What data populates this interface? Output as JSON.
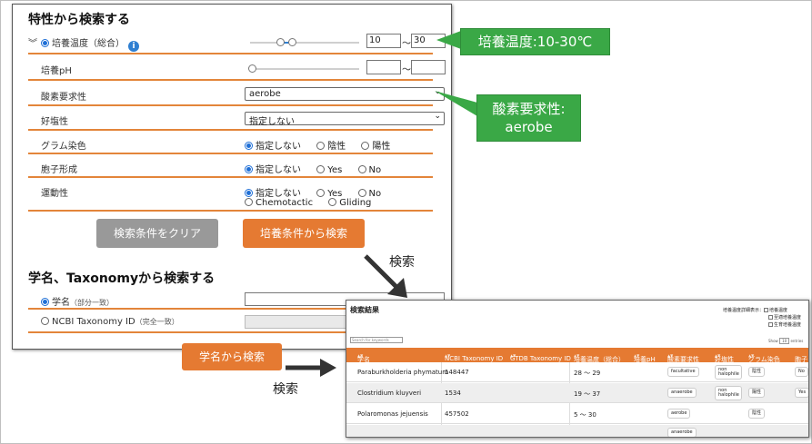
{
  "section1": {
    "title": "特性から検索する",
    "temp": {
      "label": "培養温度（総合）",
      "info_icon": "i",
      "min": "10",
      "max": "30",
      "tilde": "〜"
    },
    "ph": {
      "label": "培養pH",
      "min": "",
      "max": "",
      "tilde": "〜"
    },
    "oxygen": {
      "label": "酸素要求性",
      "value": "aerobe"
    },
    "halo": {
      "label": "好塩性",
      "value": "指定しない"
    },
    "gram": {
      "label": "グラム染色",
      "options": [
        "指定しない",
        "陰性",
        "陽性"
      ]
    },
    "spore": {
      "label": "胞子形成",
      "options": [
        "指定しない",
        "Yes",
        "No"
      ]
    },
    "motility": {
      "label": "運動性",
      "options": [
        "指定しない",
        "Yes",
        "No",
        "Chemotactic",
        "Gliding"
      ]
    },
    "clear_button": "検索条件をクリア",
    "search_button": "培養条件から検索"
  },
  "section2": {
    "title": "学名、Taxonomyから検索する",
    "name": {
      "label": "学名",
      "note": "（部分一致）"
    },
    "taxid": {
      "label": "NCBI Taxonomy ID",
      "note": "（完全一致）"
    },
    "search_button": "学名から検索"
  },
  "callouts": {
    "temp": "培養温度:10-30℃",
    "oxygen_line1": "酸素要求性:",
    "oxygen_line2": "aerobe"
  },
  "notes": {
    "search1": "検索",
    "search2": "検索"
  },
  "results": {
    "title": "検索結果",
    "search_placeholder": "Search for keywords",
    "options_label": "培養温度詳細表示：",
    "options": [
      "培養温度",
      "至適培養温度",
      "生育培養温度"
    ],
    "show_label": "Show",
    "show_value": "10",
    "show_suffix": "entries",
    "columns": [
      "学名",
      "NCBI Taxonomy ID",
      "GTDB Taxonomy ID",
      "培養温度（総合）",
      "培養pH",
      "酸素要求性",
      "好塩性",
      "グラム染色",
      "胞子"
    ],
    "sort_mark": "▲▼",
    "rows": [
      {
        "name": "Paraburkholderia phymatum",
        "ncbi": "148447",
        "temp": "28 〜 29",
        "oxygen": "facultative",
        "halo": "non halophile",
        "gram": "陰性",
        "spore": "No"
      },
      {
        "name": "Clostridium kluyveri",
        "ncbi": "1534",
        "temp": "19 〜 37",
        "oxygen": "anaerobe",
        "halo": "non halophile",
        "gram": "陽性",
        "spore": "Yes"
      },
      {
        "name": "Polaromonas jejuensis",
        "ncbi": "457502",
        "temp": "5 〜 30",
        "oxygen": "aerobe",
        "halo": "",
        "gram": "陰性",
        "spore": ""
      },
      {
        "name": "",
        "ncbi": "",
        "temp": "",
        "oxygen": "anaerobe",
        "halo": "",
        "gram": "",
        "spore": ""
      }
    ]
  },
  "colors": {
    "accent": "#e57a32",
    "callout": "#3aa846",
    "link": "#2f7fd1"
  }
}
